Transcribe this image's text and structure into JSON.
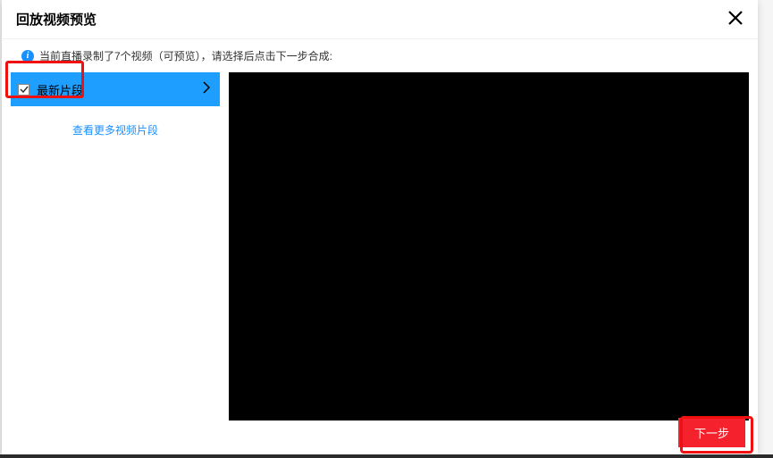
{
  "header": {
    "title": "回放视频预览"
  },
  "info": {
    "text": "当前直播录制了7个视频（可预览），请选择后点击下一步合成:"
  },
  "sidebar": {
    "segment": {
      "checked": true,
      "label": "最新片段"
    },
    "more_link": "查看更多视频片段"
  },
  "footer": {
    "next_label": "下一步"
  }
}
